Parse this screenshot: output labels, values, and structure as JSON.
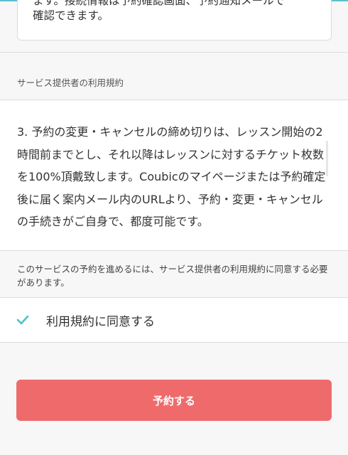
{
  "info_card": {
    "lines": [
      "ます。接続情報は予約確認画面、予約通知メールで",
      "確認できます。"
    ]
  },
  "terms": {
    "section_label": "サービス提供者の利用規約",
    "text": "3. 予約の変更・キャンセルの締め切りは、レッスン開始の2時間前までとし、それ以降はレッスンに対するチケット枚数を100%頂戴致します。Coubicのマイページまたは予約確定後に届く案内メール内のURLより、予約・変更・キャンセルの手続きがご自身で、都度可能です。"
  },
  "notice": "このサービスの予約を進めるには、サービス提供者の利用規約に同意する必要があります。",
  "agree": {
    "label": "利用規約に同意する",
    "checked": true
  },
  "submit": {
    "label": "予約する"
  },
  "colors": {
    "accent": "#5bc0d0",
    "check": "#4fc3c0",
    "button": "#ef6b6b"
  },
  "icons": {
    "checkmark": "check-icon"
  }
}
